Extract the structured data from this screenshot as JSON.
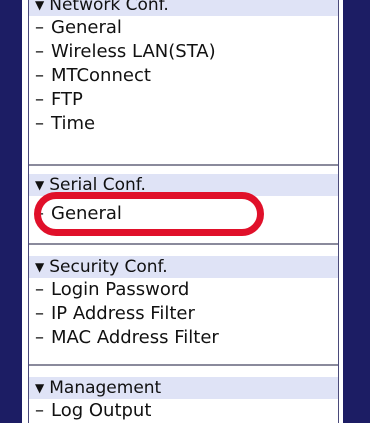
{
  "sections": [
    {
      "header": "Network Conf.",
      "items": [
        "General",
        "Wireless LAN(STA)",
        "MTConnect",
        "FTP",
        "Time"
      ]
    },
    {
      "header": "Serial Conf.",
      "items": [
        "General"
      ]
    },
    {
      "header": "Security Conf.",
      "items": [
        "Login Password",
        "IP Address Filter",
        "MAC Address Filter"
      ]
    },
    {
      "header": "Management",
      "items": [
        "Log Output"
      ]
    }
  ],
  "glyphs": {
    "expand": "▼",
    "dash": "–"
  },
  "colors": {
    "frame": "#1c1d64",
    "header_bg": "#dfe3f6",
    "highlight": "#e0102a"
  }
}
